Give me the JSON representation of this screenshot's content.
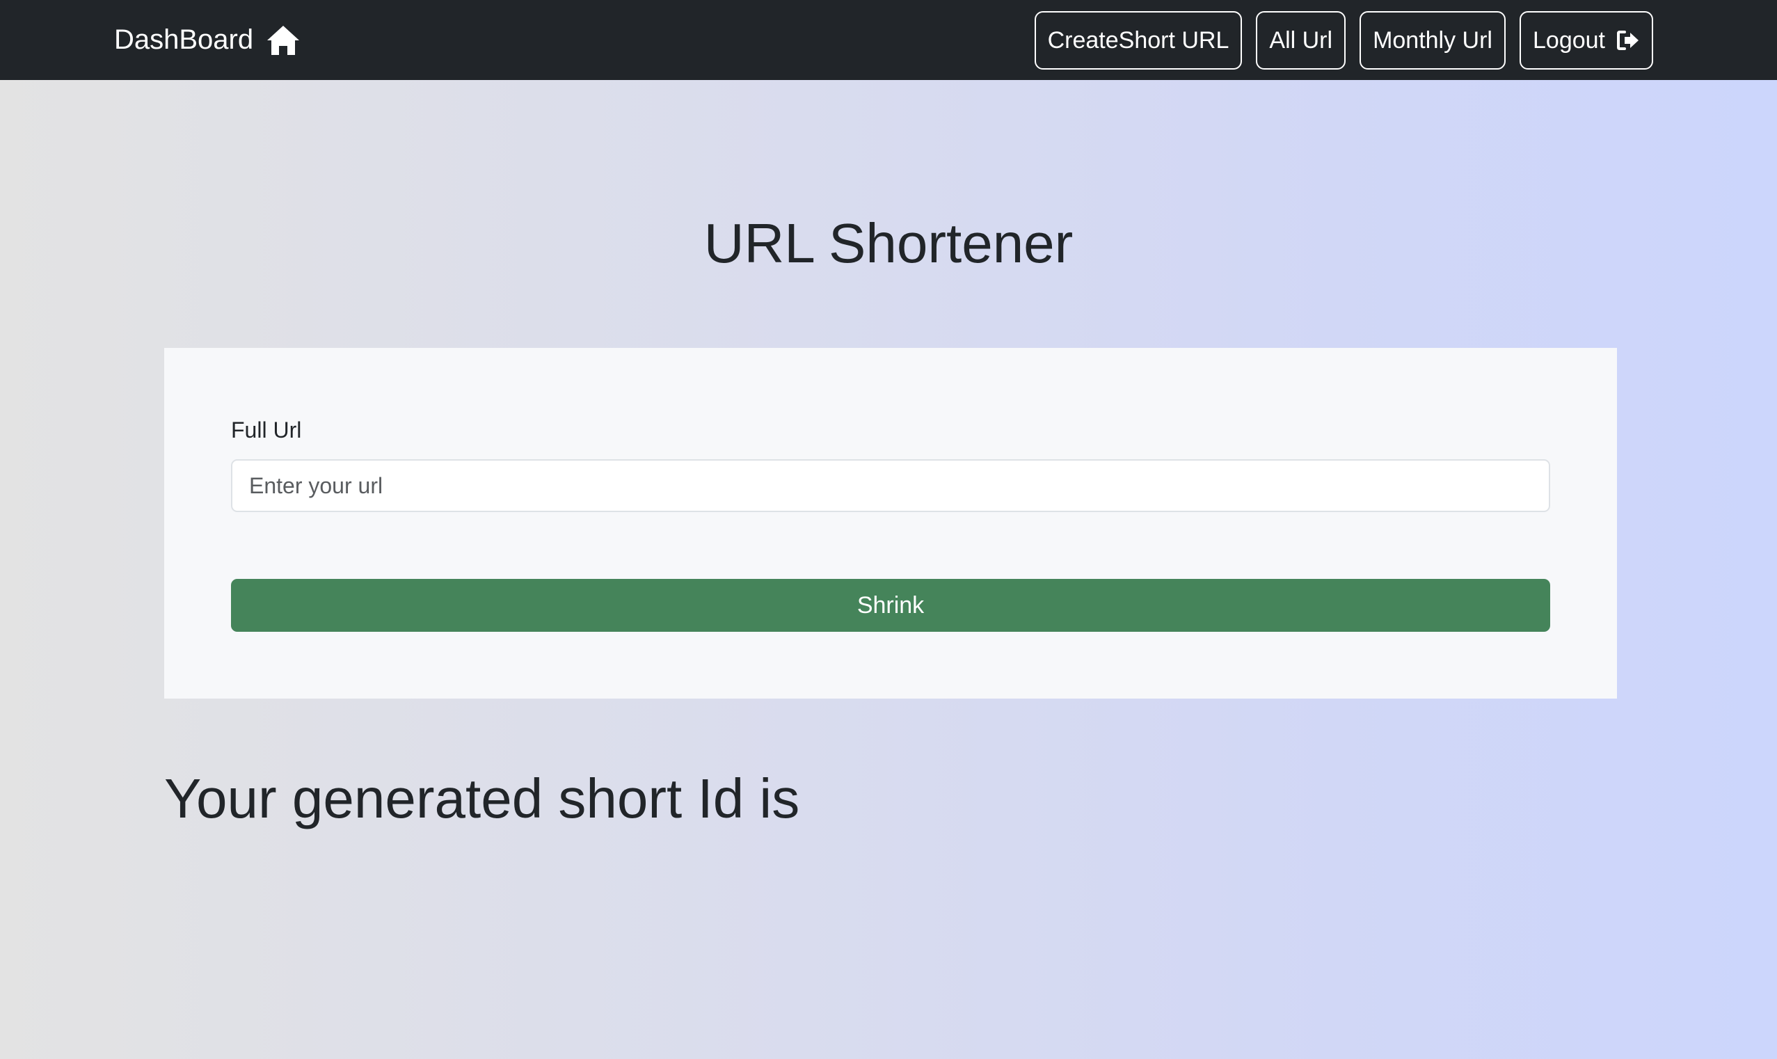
{
  "navbar": {
    "brand": "DashBoard",
    "brand_icon": "home-icon",
    "buttons": {
      "create_short_url": "CreateShort URL",
      "all_url": "All Url",
      "monthly_url": "Monthly Url",
      "logout": "Logout"
    },
    "logout_icon": "sign-out-icon"
  },
  "main": {
    "title": "URL Shortener",
    "form": {
      "label": "Full Url",
      "input_placeholder": "Enter your url",
      "input_value": "",
      "submit_label": "Shrink"
    },
    "result_heading": "Your generated short Id is"
  },
  "colors": {
    "navbar_bg": "#212529",
    "button_green": "#45845a",
    "card_bg": "#f7f8fa"
  }
}
